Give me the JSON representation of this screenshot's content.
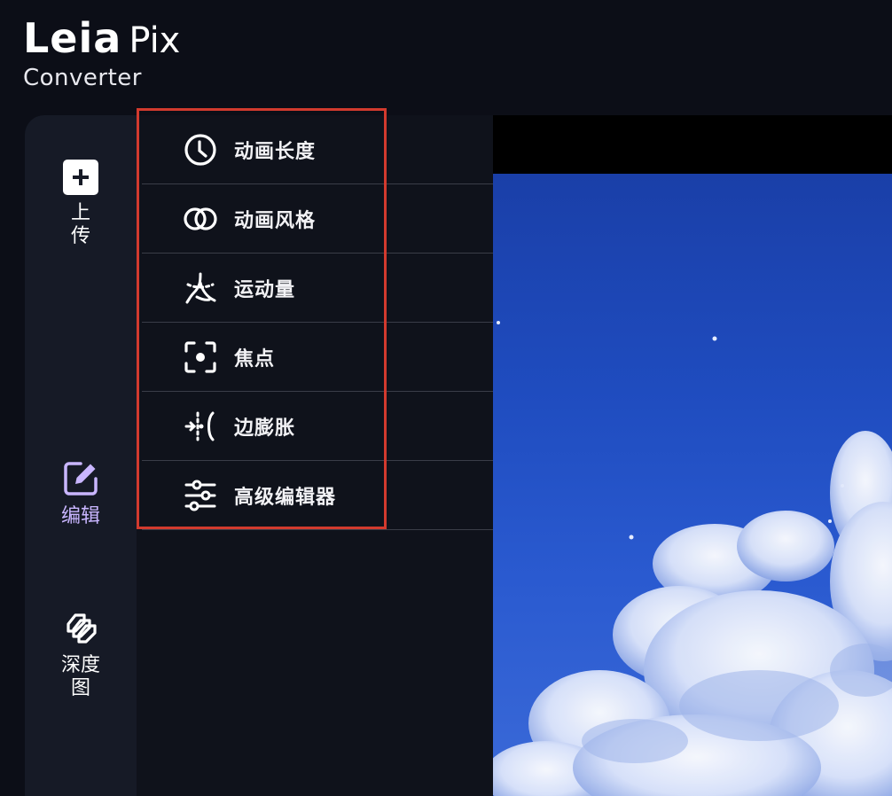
{
  "logo": {
    "brand": "Leia",
    "product": "Pix",
    "subtitle": "Converter"
  },
  "rail": {
    "items": [
      {
        "key": "upload",
        "label": "上传",
        "icon": "plus-square-icon"
      },
      {
        "key": "edit",
        "label": "编辑",
        "icon": "edit-icon",
        "active": true
      },
      {
        "key": "depth",
        "label": "深度图",
        "icon": "depth-layers-icon"
      }
    ]
  },
  "submenu": {
    "items": [
      {
        "label": "动画长度",
        "icon": "clock-icon"
      },
      {
        "label": "动画风格",
        "icon": "rings-icon"
      },
      {
        "label": "运动量",
        "icon": "motion-icon"
      },
      {
        "label": "焦点",
        "icon": "focus-icon"
      },
      {
        "label": "边膨胀",
        "icon": "edge-dilation-icon"
      },
      {
        "label": "高级编辑器",
        "icon": "sliders-icon"
      }
    ]
  },
  "colors": {
    "background": "#0c0e17",
    "rail": "#161a26",
    "panel": "#0f121b",
    "active_label": "#c9b6ff",
    "highlight": "#d23a2e",
    "sky": "#1f4cbf"
  }
}
